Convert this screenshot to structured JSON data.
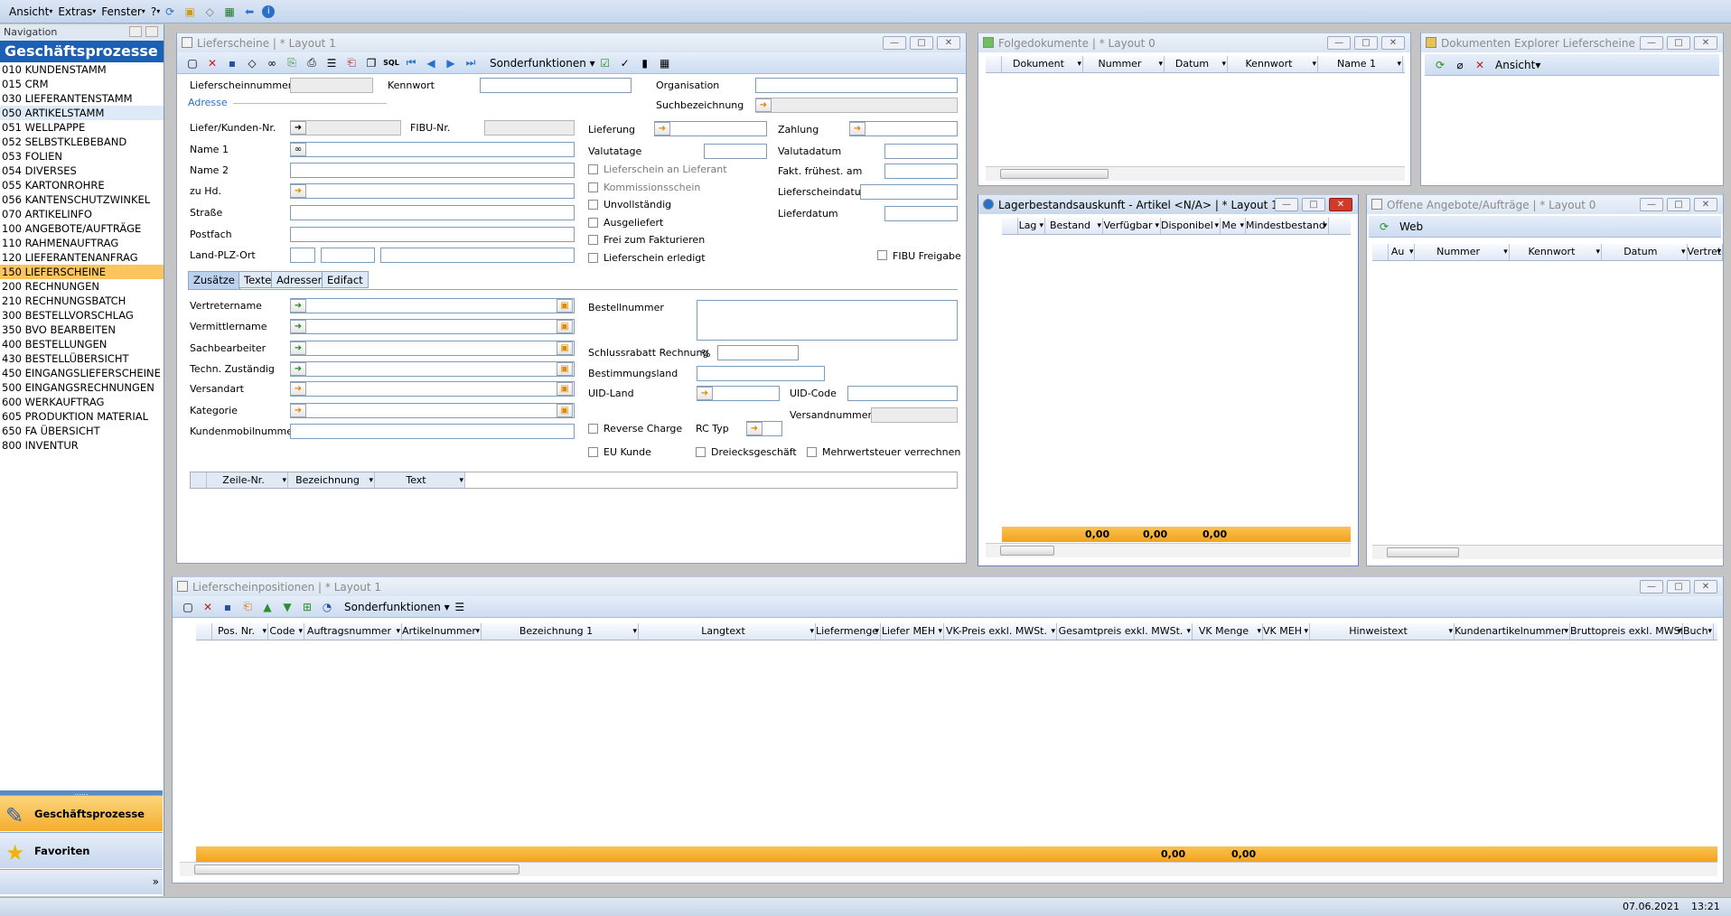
{
  "menu": [
    "Ansicht",
    "Extras",
    "Fenster",
    "?"
  ],
  "nav": {
    "header": "Navigation",
    "title": "Geschäftsprozesse",
    "items": [
      "010 KUNDENSTAMM",
      "015 CRM",
      "030 LIEFERANTENSTAMM",
      "050 ARTIKELSTAMM",
      "051 WELLPAPPE",
      "052 SELBSTKLEBEBAND",
      "053 FOLIEN",
      "054 DIVERSES",
      "055 KARTONROHRE",
      "056 KANTENSCHUTZWINKEL",
      "070 ARTIKELINFO",
      "100 ANGEBOTE/AUFTRÄGE",
      "110 RAHMENAUFTRAG",
      "120 LIEFERANTENANFRAG",
      "150 LIEFERSCHEINE",
      "200 RECHNUNGEN",
      "210 RECHNUNGSBATCH",
      "300 BESTELLVORSCHLAG",
      "350 BVO BEARBEITEN",
      "400 BESTELLUNGEN",
      "430 BESTELLÜBERSICHT",
      "450 EINGANGSLIEFERSCHEINE",
      "500 EINGANGSRECHNUNGEN",
      "600 WERKAUFTRAG",
      "605 PRODUKTION MATERIAL",
      "650 FA ÜBERSICHT",
      "800 INVENTUR"
    ],
    "selected_index": 14,
    "hover_index": 3,
    "btn_processes": "Geschäftsprozesse",
    "btn_favorites": "Favoriten"
  },
  "ls": {
    "title": "Lieferscheine | * Layout 1",
    "sonder": "Sonderfunktionen",
    "labels": {
      "lsnr": "Lieferscheinnummer",
      "kennwort": "Kennwort",
      "org": "Organisation",
      "adresse": "Adresse",
      "suchbez": "Suchbezeichnung",
      "lkdnr": "Liefer/Kunden-Nr.",
      "fibunr": "FIBU-Nr.",
      "lieferung": "Lieferung",
      "zahlung": "Zahlung",
      "name1": "Name 1",
      "valutatage": "Valutatage",
      "valutadatum": "Valutadatum",
      "name2": "Name 2",
      "fakt": "Fakt. frühest. am",
      "zuhd": "zu Hd.",
      "lsdatum": "Lieferscheindatum",
      "strasse": "Straße",
      "lieferdatum": "Lieferdatum",
      "postfach": "Postfach",
      "lpo": "Land-PLZ-Ort",
      "fibufreigabe": "FIBU Freigabe"
    },
    "checks": [
      "Lieferschein an Lieferant",
      "Kommissionsschein",
      "Unvollständig",
      "Ausgeliefert",
      "Frei zum Fakturieren",
      "Lieferschein erledigt"
    ],
    "tabs": [
      "Zusätze",
      "Texte",
      "Adressen",
      "Edifact"
    ],
    "zusatz": {
      "vertreter": "Vertretername",
      "vermittler": "Vermittlername",
      "sachbearbeiter": "Sachbearbeiter",
      "techn": "Techn. Zuständig",
      "versandart": "Versandart",
      "kategorie": "Kategorie",
      "kmobil": "Kundenmobilnummer",
      "bestellnr": "Bestellnummer",
      "schluss": "Schlussrabatt Rechnung",
      "schluss_sym": "%",
      "bestland": "Bestimmungsland",
      "uidland": "UID-Land",
      "uidcode": "UID-Code",
      "versandnr": "Versandnummer",
      "reverse": "Reverse Charge",
      "rctyp": "RC Typ",
      "eukunde": "EU Kunde",
      "dreieck": "Dreiecksgeschäft",
      "mwst": "Mehrwertsteuer verrechnen"
    },
    "grid": [
      "Zeile-Nr.",
      "Bezeichnung",
      "Text"
    ]
  },
  "folge": {
    "title": "Folgedokumente | * Layout 0",
    "cols": [
      "Dokument",
      "Nummer",
      "Datum",
      "Kennwort",
      "Name 1"
    ]
  },
  "explorer": {
    "title": "Dokumenten Explorer Lieferscheine | ...",
    "ansicht": "Ansicht"
  },
  "lager": {
    "title": "Lagerbestandsauskunft - Artikel <N/A> | * Layout 1",
    "cols": [
      "Lag",
      "Bestand",
      "Verfügbar",
      "Disponibel",
      "Me",
      "Mindestbestand"
    ],
    "sums": [
      "0,00",
      "0,00",
      "0,00"
    ]
  },
  "offene": {
    "title": "Offene Angebote/Aufträge | * Layout 0",
    "web": "Web",
    "cols": [
      "Au",
      "Nummer",
      "Kennwort",
      "Datum",
      "Vertrete"
    ]
  },
  "pos": {
    "title": "Lieferscheinpositionen | * Layout 1",
    "sonder": "Sonderfunktionen",
    "cols": [
      "Pos. Nr.",
      "Code",
      "Auftragsnummer",
      "Artikelnummer",
      "Bezeichnung 1",
      "Langtext",
      "Liefermenge",
      "Liefer MEH",
      "VK-Preis exkl. MWSt.",
      "Gesamtpreis exkl. MWSt.",
      "VK Menge",
      "VK MEH",
      "Hinweistext",
      "Kundenartikelnummer",
      "Bruttopreis exkl. MWSt.",
      "Buch"
    ],
    "sums": [
      "0,00",
      "0,00"
    ]
  },
  "status": {
    "date": "07.06.2021",
    "time": "13:21"
  },
  "colors": {
    "nav_title": "#1c60b4",
    "selection": "#fcc45d",
    "sum_bar": "#f3a31c"
  }
}
